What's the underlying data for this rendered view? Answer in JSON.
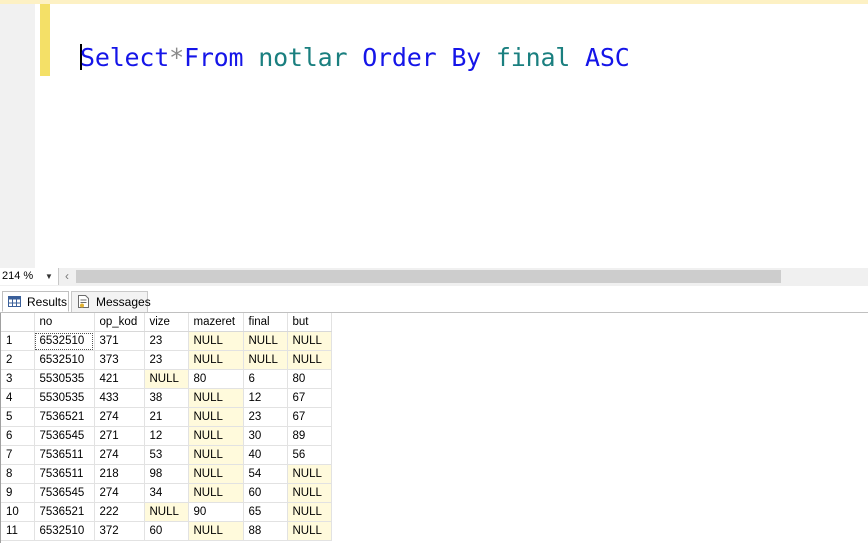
{
  "editor": {
    "tokens": [
      {
        "text": "Select",
        "kind": "kw"
      },
      {
        "text": "*",
        "kind": "op"
      },
      {
        "text": "From",
        "kind": "kw"
      },
      {
        "text": " ",
        "kind": "ws"
      },
      {
        "text": "notlar",
        "kind": "id"
      },
      {
        "text": " ",
        "kind": "ws"
      },
      {
        "text": "Order",
        "kind": "kw"
      },
      {
        "text": " ",
        "kind": "ws"
      },
      {
        "text": "By",
        "kind": "kw"
      },
      {
        "text": " ",
        "kind": "ws"
      },
      {
        "text": "final",
        "kind": "id"
      },
      {
        "text": " ",
        "kind": "ws"
      },
      {
        "text": "ASC",
        "kind": "kw"
      }
    ],
    "colors": {
      "keyword": "#1515e8",
      "operator": "#8a8a8a",
      "identifier": "#1a7f7f",
      "change_marker": "#f4e067"
    }
  },
  "zoom": {
    "value": "214 %"
  },
  "tabs": {
    "results_label": "Results",
    "messages_label": "Messages",
    "results_icon": "results-grid-icon",
    "messages_icon": "messages-icon"
  },
  "grid": {
    "columns": [
      "no",
      "op_kod",
      "vize",
      "mazeret",
      "final",
      "but"
    ],
    "null_text": "NULL",
    "null_color": "#fffadc",
    "rows": [
      {
        "row_number": "1",
        "cells": [
          "6532510",
          "371",
          "23",
          "NULL",
          "NULL",
          "NULL"
        ]
      },
      {
        "row_number": "2",
        "cells": [
          "6532510",
          "373",
          "23",
          "NULL",
          "NULL",
          "NULL"
        ]
      },
      {
        "row_number": "3",
        "cells": [
          "5530535",
          "421",
          "NULL",
          "80",
          "6",
          "80"
        ]
      },
      {
        "row_number": "4",
        "cells": [
          "5530535",
          "433",
          "38",
          "NULL",
          "12",
          "67"
        ]
      },
      {
        "row_number": "5",
        "cells": [
          "7536521",
          "274",
          "21",
          "NULL",
          "23",
          "67"
        ]
      },
      {
        "row_number": "6",
        "cells": [
          "7536545",
          "271",
          "12",
          "NULL",
          "30",
          "89"
        ]
      },
      {
        "row_number": "7",
        "cells": [
          "7536511",
          "274",
          "53",
          "NULL",
          "40",
          "56"
        ]
      },
      {
        "row_number": "8",
        "cells": [
          "7536511",
          "218",
          "98",
          "NULL",
          "54",
          "NULL"
        ]
      },
      {
        "row_number": "9",
        "cells": [
          "7536545",
          "274",
          "34",
          "NULL",
          "60",
          "NULL"
        ]
      },
      {
        "row_number": "10",
        "cells": [
          "7536521",
          "222",
          "NULL",
          "90",
          "65",
          "NULL"
        ]
      },
      {
        "row_number": "11",
        "cells": [
          "6532510",
          "372",
          "60",
          "NULL",
          "88",
          "NULL"
        ]
      }
    ]
  }
}
